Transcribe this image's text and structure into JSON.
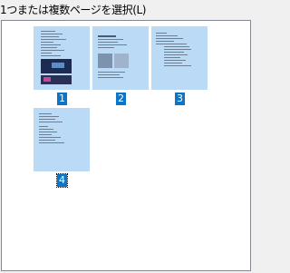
{
  "dialog": {
    "group_label": "1つまたは複数ページを選択(L)"
  },
  "pages": [
    {
      "number": "1",
      "selected": true,
      "focused": false
    },
    {
      "number": "2",
      "selected": true,
      "focused": false
    },
    {
      "number": "3",
      "selected": true,
      "focused": false
    },
    {
      "number": "4",
      "selected": true,
      "focused": true
    }
  ],
  "colors": {
    "selection_fill": "#bbdaf5",
    "number_badge": "#0c75c7",
    "border": "#828790"
  }
}
